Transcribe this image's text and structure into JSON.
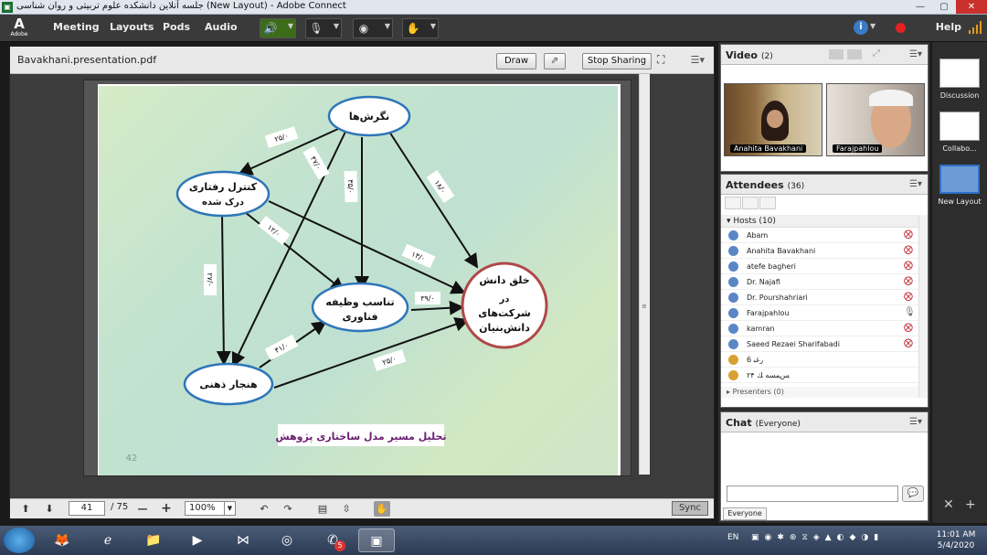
{
  "window": {
    "title": "جلسه آنلاین دانشکده علوم تربیتی و روان شناسی (New Layout) - Adobe Connect",
    "app_icon": "adobe-connect-icon"
  },
  "menubar": {
    "logo_letter": "A",
    "logo_text": "Adobe",
    "items": [
      "Meeting",
      "Layouts",
      "Pods",
      "Audio"
    ],
    "help": "Help",
    "speaker_active_color": "#3c6b1a",
    "record_color": "#e32222"
  },
  "share_pod": {
    "filename": "Bavakhani.presentation.pdf",
    "draw_button": "Draw",
    "stop_sharing_button": "Stop Sharing",
    "page_current": "41",
    "page_total": "/ 75",
    "zoom": "100%",
    "sync_button": "Sync"
  },
  "slide": {
    "page_number": "42",
    "caption": "تحلیل مسیر مدل ساختاری پژوهش",
    "nodes": {
      "attitude": "نگرش‌ها",
      "perceived_control_1": "کنترل رفتاری",
      "perceived_control_2": "درک شده",
      "norm": "هنجار ذهنی",
      "tech_fit_1": "تناسب وظیفه",
      "tech_fit_2": "فناوری",
      "knowledge_1": "خلق دانش",
      "knowledge_2": "در",
      "knowledge_3": "شرکت‌های",
      "knowledge_4": "دانش‌بنیان"
    },
    "paths": {
      "attitude_control": "۲۵/۰",
      "attitude_norm": "۴۷/۰",
      "attitude_fit": "۳۵/۰",
      "attitude_knowledge": "۱۸/۰",
      "control_norm": "۲۷/۰",
      "control_fit": "۱۲/۰",
      "control_knowledge": "۱۳/۰",
      "fit_knowledge": "۳۹/۰",
      "norm_fit": "۴۱/۰",
      "norm_knowledge": "۲۵/۰"
    }
  },
  "video_pod": {
    "title": "Video",
    "count": "(2)",
    "participants": [
      "Anahita Bavakhani",
      "Farajpahlou"
    ]
  },
  "attendees_pod": {
    "title": "Attendees",
    "count": "(36)",
    "hosts_header": "Hosts (10)",
    "hosts": [
      "Abam",
      "Anahita Bavakhani",
      "atefe bagheri",
      "Dr. Najafi",
      "Dr. Pourshahriari",
      "Farajpahlou",
      "kamran",
      "Saeed Rezaei Sharifabadi",
      "6 ﺭﻏﺒ",
      "ﺲﻤﺴﻪ ﻚ ۲۴"
    ],
    "presenters_header": "Presenters (0)"
  },
  "chat_pod": {
    "title": "Chat",
    "audience": "(Everyone)",
    "tab": "Everyone"
  },
  "layouts": {
    "items": [
      "Discussion",
      "Collabo...",
      "New Layout"
    ],
    "selected": "New Layout"
  },
  "taskbar": {
    "language": "EN",
    "time": "11:01 AM",
    "date": "5/4/2020",
    "whatsapp_badge": "5"
  }
}
